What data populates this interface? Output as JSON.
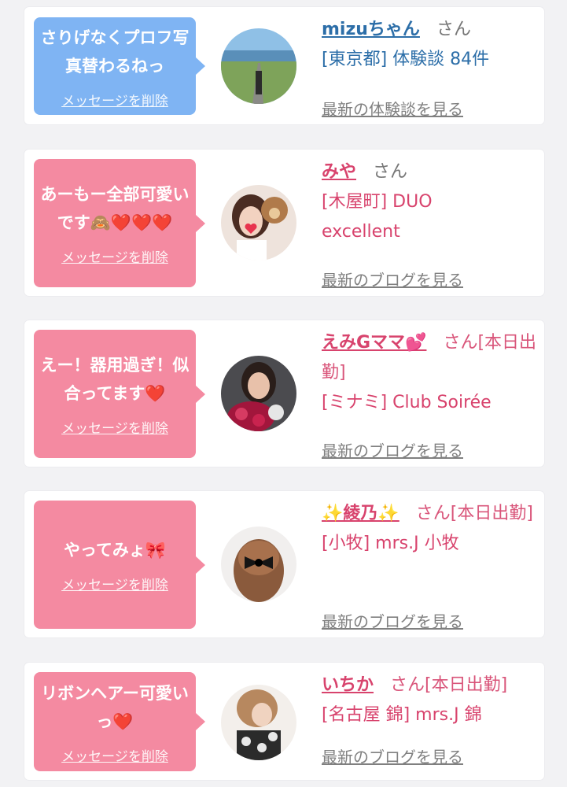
{
  "cards": [
    {
      "message": "さりげなくプロフ写真替わるねっ",
      "delete_label": "メッセージを削除",
      "name": "mizuちゃん",
      "honorific": "さん",
      "detail": "[東京都] 体験談 84件",
      "latest_link": "最新の体験談を見る"
    },
    {
      "message": "あーもー全部可愛いです🙈❤️❤️❤️",
      "delete_label": "メッセージを削除",
      "name": "みや",
      "honorific": "さん",
      "detail": "[木屋町] DUO excellent",
      "latest_link": "最新のブログを見る"
    },
    {
      "message": "えー！器用過ぎ！似合ってます❤️",
      "delete_label": "メッセージを削除",
      "name": "えみGママ💕",
      "honorific": "さん[本日出勤]",
      "detail": "[ミナミ] Club Soirée",
      "latest_link": "最新のブログを見る"
    },
    {
      "message": "やってみょ🎀",
      "delete_label": "メッセージを削除",
      "name": "✨綾乃✨",
      "honorific": "さん[本日出勤]",
      "detail": "[小牧] mrs.J 小牧",
      "latest_link": "最新のブログを見る"
    },
    {
      "message": "リボンヘアー可愛いっ❤️",
      "delete_label": "メッセージを削除",
      "name": "いちか",
      "honorific": "さん[本日出勤]",
      "detail": "[名古屋 錦] mrs.J 錦",
      "latest_link": "最新のブログを見る"
    }
  ],
  "colors": {
    "blue_bubble": "#7fb4f3",
    "pink_bubble": "#f48aa1",
    "blue_text": "#2c6ea8",
    "pink_text": "#d8436d"
  }
}
